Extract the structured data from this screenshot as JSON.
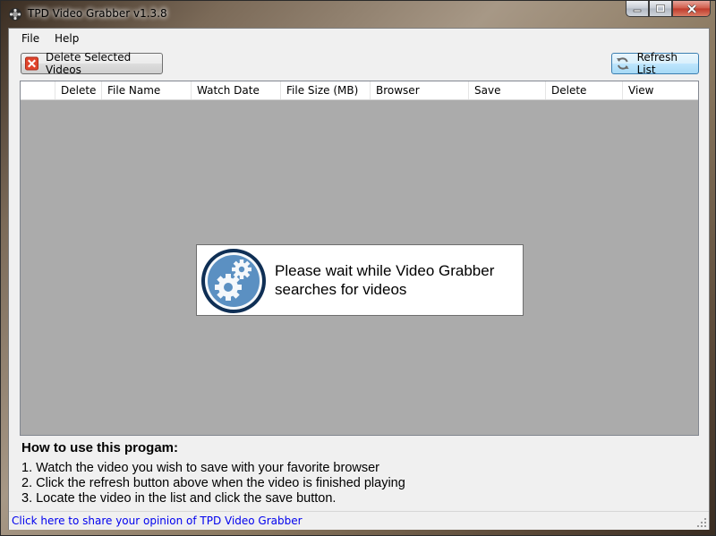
{
  "window": {
    "title": "TPD Video Grabber v1.3.8"
  },
  "menu": {
    "items": [
      "File",
      "Help"
    ]
  },
  "toolbar": {
    "delete_label": "Delete Selected Videos",
    "refresh_label": "Refresh List"
  },
  "grid": {
    "columns": [
      "Delete",
      "File Name",
      "Watch Date",
      "File Size (MB)",
      "Browser",
      "Save",
      "Delete",
      "View"
    ],
    "rows": []
  },
  "wait_message": {
    "line1": "Please wait while Video Grabber",
    "line2": "searches for videos"
  },
  "howto": {
    "title": "How to use this progam:",
    "steps": [
      "1. Watch the video you wish to save with your favorite browser",
      "2. Click the refresh button above when the video is finished playing",
      "3. Locate the video in the list and click the save button."
    ]
  },
  "status": {
    "link_text": "Click here to share your opinion of TPD Video Grabber"
  },
  "colors": {
    "link": "#0000ee",
    "grid_bg": "#ababab",
    "accent_blue": "#4a86b8"
  },
  "icons": {
    "app": "app-icon",
    "delete": "red-x-icon",
    "refresh": "refresh-icon",
    "wait": "gears-icon"
  }
}
